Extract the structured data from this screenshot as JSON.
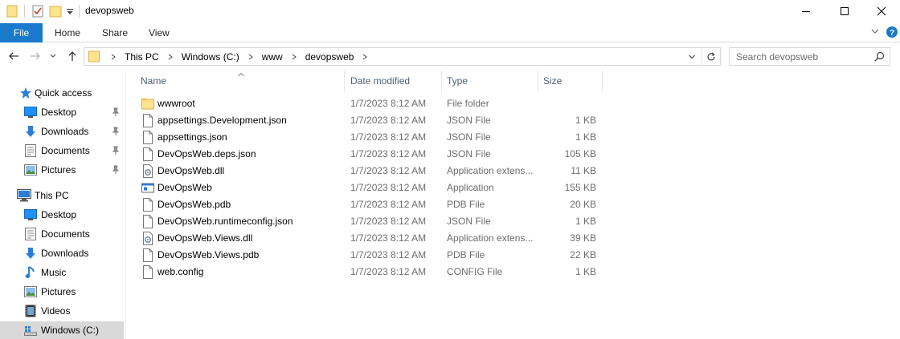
{
  "window": {
    "title": "devopsweb",
    "minimize_icon": "minimize-icon",
    "maximize_icon": "maximize-icon",
    "close_icon": "close-icon"
  },
  "ribbon": {
    "tabs": [
      {
        "label": "File"
      },
      {
        "label": "Home"
      },
      {
        "label": "Share"
      },
      {
        "label": "View"
      }
    ],
    "accent": "#1979ca"
  },
  "address": {
    "crumbs": [
      "This PC",
      "Windows (C:)",
      "www",
      "devopsweb"
    ]
  },
  "search": {
    "placeholder": "Search devopsweb"
  },
  "navpane": {
    "items": [
      {
        "label": "Quick access",
        "icon": "star-icon",
        "pinned": false
      },
      {
        "label": "Desktop",
        "icon": "desktop-icon",
        "pinned": true
      },
      {
        "label": "Downloads",
        "icon": "download-icon",
        "pinned": true
      },
      {
        "label": "Documents",
        "icon": "documents-icon",
        "pinned": true
      },
      {
        "label": "Pictures",
        "icon": "pictures-icon",
        "pinned": true
      },
      {
        "label": "This PC",
        "icon": "computer-icon",
        "pinned": false
      },
      {
        "label": "Desktop",
        "icon": "desktop-icon",
        "pinned": false
      },
      {
        "label": "Documents",
        "icon": "documents-icon",
        "pinned": false
      },
      {
        "label": "Downloads",
        "icon": "download-icon",
        "pinned": false
      },
      {
        "label": "Music",
        "icon": "music-icon",
        "pinned": false
      },
      {
        "label": "Pictures",
        "icon": "pictures-icon",
        "pinned": false
      },
      {
        "label": "Videos",
        "icon": "videos-icon",
        "pinned": false
      },
      {
        "label": "Windows (C:)",
        "icon": "drive-icon",
        "pinned": false,
        "selected": true
      }
    ]
  },
  "filelist": {
    "columns": {
      "name": "Name",
      "date": "Date modified",
      "type": "Type",
      "size": "Size"
    },
    "rows": [
      {
        "name": "wwwroot",
        "date": "1/7/2023 8:12 AM",
        "type": "File folder",
        "size": "",
        "icon": "folder-icon"
      },
      {
        "name": "appsettings.Development.json",
        "date": "1/7/2023 8:12 AM",
        "type": "JSON File",
        "size": "1 KB",
        "icon": "file-icon"
      },
      {
        "name": "appsettings.json",
        "date": "1/7/2023 8:12 AM",
        "type": "JSON File",
        "size": "1 KB",
        "icon": "file-icon"
      },
      {
        "name": "DevOpsWeb.deps.json",
        "date": "1/7/2023 8:12 AM",
        "type": "JSON File",
        "size": "105 KB",
        "icon": "file-icon"
      },
      {
        "name": "DevOpsWeb.dll",
        "date": "1/7/2023 8:12 AM",
        "type": "Application extens...",
        "size": "11 KB",
        "icon": "dll-icon"
      },
      {
        "name": "DevOpsWeb",
        "date": "1/7/2023 8:12 AM",
        "type": "Application",
        "size": "155 KB",
        "icon": "application-icon"
      },
      {
        "name": "DevOpsWeb.pdb",
        "date": "1/7/2023 8:12 AM",
        "type": "PDB File",
        "size": "20 KB",
        "icon": "file-icon"
      },
      {
        "name": "DevOpsWeb.runtimeconfig.json",
        "date": "1/7/2023 8:12 AM",
        "type": "JSON File",
        "size": "1 KB",
        "icon": "file-icon"
      },
      {
        "name": "DevOpsWeb.Views.dll",
        "date": "1/7/2023 8:12 AM",
        "type": "Application extens...",
        "size": "39 KB",
        "icon": "dll-icon"
      },
      {
        "name": "DevOpsWeb.Views.pdb",
        "date": "1/7/2023 8:12 AM",
        "type": "PDB File",
        "size": "22 KB",
        "icon": "file-icon"
      },
      {
        "name": "web.config",
        "date": "1/7/2023 8:12 AM",
        "type": "CONFIG File",
        "size": "1 KB",
        "icon": "file-icon"
      }
    ]
  }
}
